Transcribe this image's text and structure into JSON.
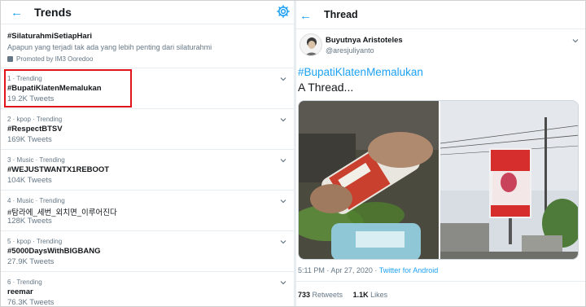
{
  "left_panel": {
    "title": "Trends",
    "back_icon": "back-arrow-icon",
    "settings_icon": "gear-icon",
    "promoted": {
      "name": "#SilaturahmiSetiapHari",
      "description": "Apapun yang terjadi tak ada yang lebih penting dari silaturahmi",
      "promoted_by": "Promoted by IM3 Ooredoo"
    },
    "trends": [
      {
        "meta": "1 · Trending",
        "name": "#BupatiKlatenMemalukan",
        "count": "19.2K Tweets"
      },
      {
        "meta": "2 · kpop · Trending",
        "name": "#RespectBTSV",
        "count": "169K Tweets"
      },
      {
        "meta": "3 · Music · Trending",
        "name": "#WEJUSTWANTX1REBOOT",
        "count": "104K Tweets"
      },
      {
        "meta": "4 · Music · Trending",
        "name": "#탐라에_세번_외치면_이루어진다",
        "count": "128K Tweets"
      },
      {
        "meta": "5 · kpop · Trending",
        "name": "#5000DaysWithBIGBANG",
        "count": "27.9K Tweets"
      },
      {
        "meta": "6 · Trending",
        "name": "reemar",
        "count": "76.3K Tweets"
      }
    ],
    "highlight_color": "#e0151c"
  },
  "right_panel": {
    "title": "Thread",
    "tweet": {
      "author": "Buyutnya Aristoteles",
      "handle": "@aresjuliyanto",
      "hashtag": "#BupatiKlatenMemalukan",
      "text": "A Thread...",
      "date": "5:11 PM · Apr 27, 2020 · ",
      "source": "Twitter for Android",
      "retweets": "733",
      "retweets_label": " Retweets",
      "likes": "1.1K",
      "likes_label": " Likes"
    }
  },
  "colors": {
    "accent": "#1da1f2",
    "secondary_text": "#657786",
    "border": "#e6ecf0"
  }
}
